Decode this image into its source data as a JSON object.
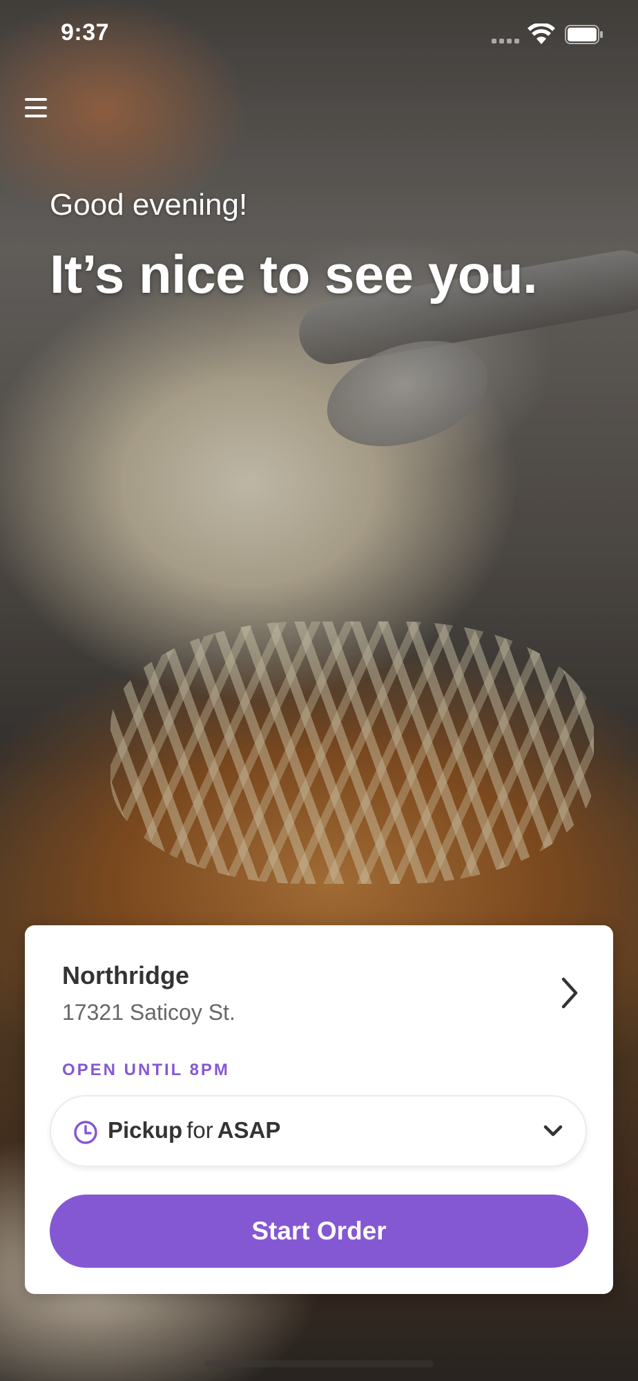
{
  "status_bar": {
    "time": "9:37"
  },
  "header": {
    "menu_icon": "hamburger-menu-icon"
  },
  "hero": {
    "greeting": "Good evening!",
    "headline": "It’s nice to see you."
  },
  "location_card": {
    "name": "Northridge",
    "address": "17321 Saticoy St.",
    "hours": "OPEN UNTIL 8PM",
    "pickup": {
      "mode": "Pickup",
      "connector": "for",
      "time": "ASAP"
    },
    "start_order_label": "Start Order"
  },
  "colors": {
    "accent": "#8558d3",
    "card_bg": "#ffffff",
    "text_primary": "#333333",
    "text_secondary": "#666666"
  }
}
